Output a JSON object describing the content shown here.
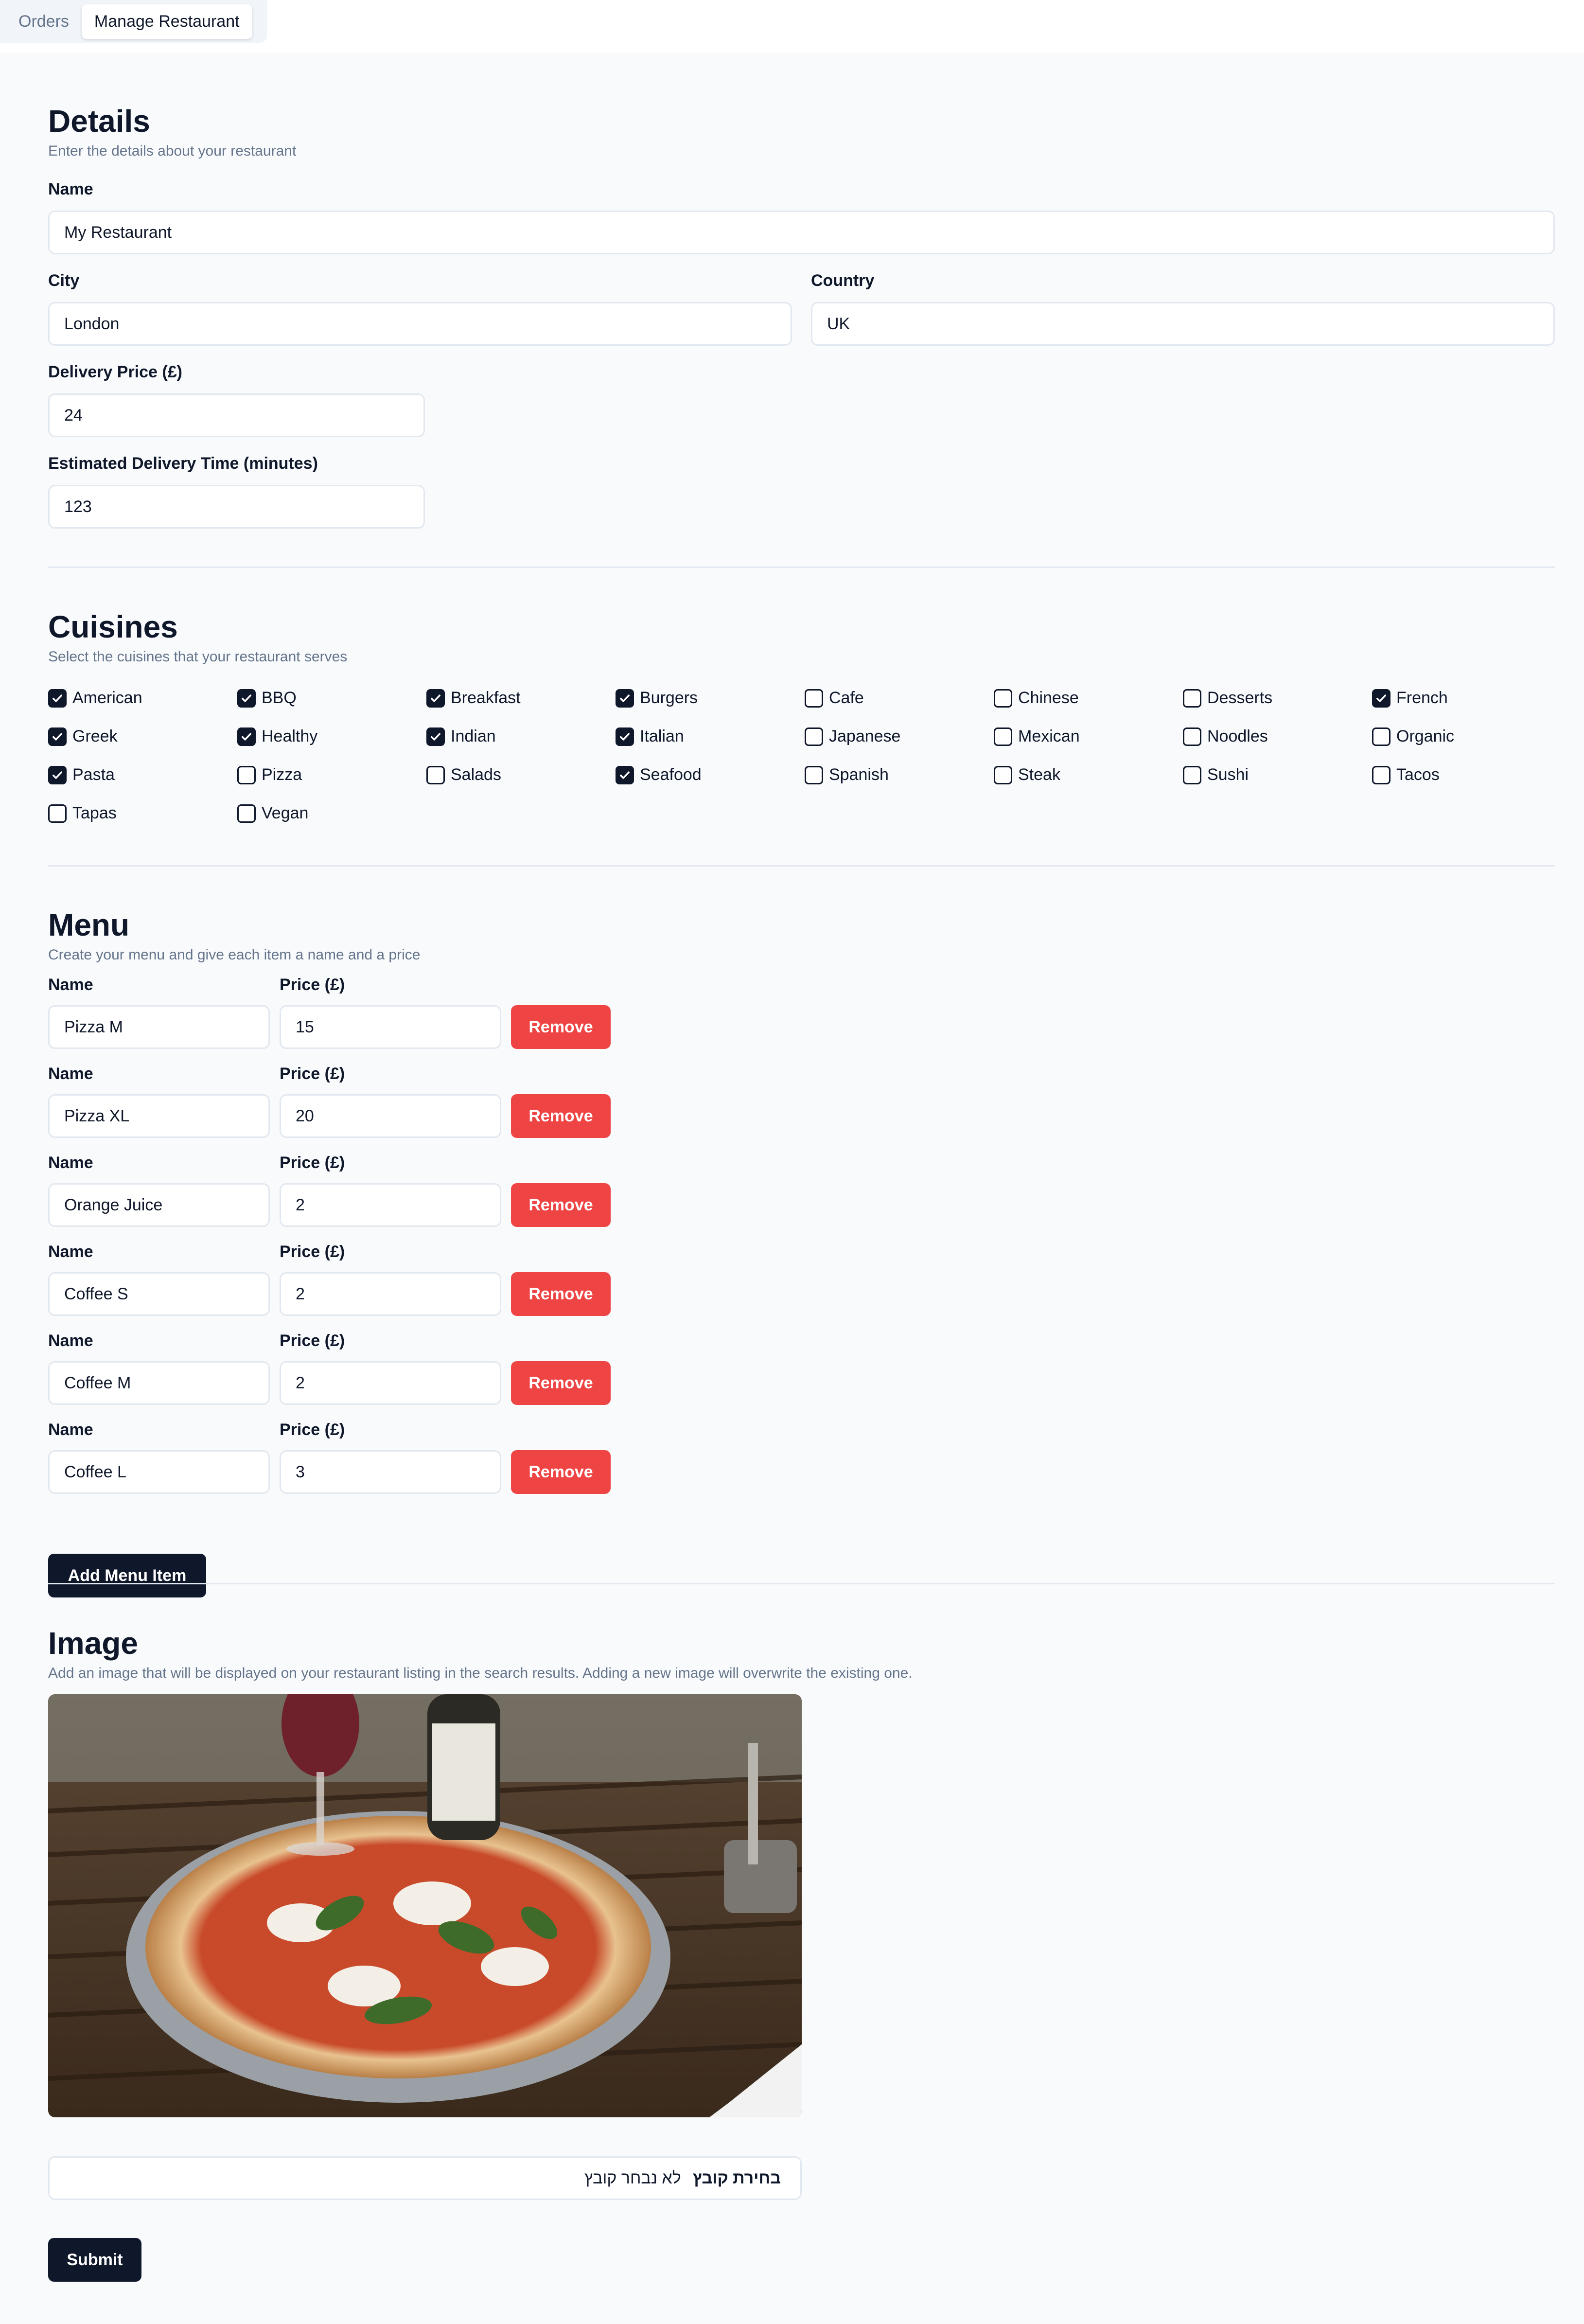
{
  "tabs": [
    {
      "label": "Orders",
      "active": false
    },
    {
      "label": "Manage Restaurant",
      "active": true
    }
  ],
  "details": {
    "title": "Details",
    "subtitle": "Enter the details about your restaurant",
    "name_label": "Name",
    "name_value": "My Restaurant",
    "city_label": "City",
    "city_value": "London",
    "country_label": "Country",
    "country_value": "UK",
    "delivery_price_label": "Delivery Price (£)",
    "delivery_price_value": "24",
    "delivery_time_label": "Estimated Delivery Time (minutes)",
    "delivery_time_value": "123"
  },
  "cuisines": {
    "title": "Cuisines",
    "subtitle": "Select the cuisines that your restaurant serves",
    "items": [
      {
        "label": "American",
        "checked": true
      },
      {
        "label": "BBQ",
        "checked": true
      },
      {
        "label": "Breakfast",
        "checked": true
      },
      {
        "label": "Burgers",
        "checked": true
      },
      {
        "label": "Cafe",
        "checked": false
      },
      {
        "label": "Chinese",
        "checked": false
      },
      {
        "label": "Desserts",
        "checked": false
      },
      {
        "label": "French",
        "checked": true
      },
      {
        "label": "Greek",
        "checked": true
      },
      {
        "label": "Healthy",
        "checked": true
      },
      {
        "label": "Indian",
        "checked": true
      },
      {
        "label": "Italian",
        "checked": true
      },
      {
        "label": "Japanese",
        "checked": false
      },
      {
        "label": "Mexican",
        "checked": false
      },
      {
        "label": "Noodles",
        "checked": false
      },
      {
        "label": "Organic",
        "checked": false
      },
      {
        "label": "Pasta",
        "checked": true
      },
      {
        "label": "Pizza",
        "checked": false
      },
      {
        "label": "Salads",
        "checked": false
      },
      {
        "label": "Seafood",
        "checked": true
      },
      {
        "label": "Spanish",
        "checked": false
      },
      {
        "label": "Steak",
        "checked": false
      },
      {
        "label": "Sushi",
        "checked": false
      },
      {
        "label": "Tacos",
        "checked": false
      },
      {
        "label": "Tapas",
        "checked": false
      },
      {
        "label": "Vegan",
        "checked": false
      }
    ]
  },
  "menu": {
    "title": "Menu",
    "subtitle": "Create your menu and give each item a name and a price",
    "name_label": "Name",
    "price_label": "Price (£)",
    "remove_label": "Remove",
    "add_label": "Add Menu Item",
    "items": [
      {
        "name": "Pizza M",
        "price": "15"
      },
      {
        "name": "Pizza XL",
        "price": "20"
      },
      {
        "name": "Orange Juice",
        "price": "2"
      },
      {
        "name": "Coffee S",
        "price": "2"
      },
      {
        "name": "Coffee M",
        "price": "2"
      },
      {
        "name": "Coffee L",
        "price": "3"
      }
    ]
  },
  "image": {
    "title": "Image",
    "subtitle": "Add an image that will be displayed on your restaurant listing in the search results. Adding a new image will overwrite the existing one.",
    "file_button": "בחירת קובץ",
    "file_status": "לא נבחר קובץ"
  },
  "submit_label": "Submit",
  "colors": {
    "background": "#f8fafc",
    "primary": "#0f172a",
    "danger": "#ef4444",
    "border": "#e2e8f0",
    "muted_text": "#64748b"
  }
}
